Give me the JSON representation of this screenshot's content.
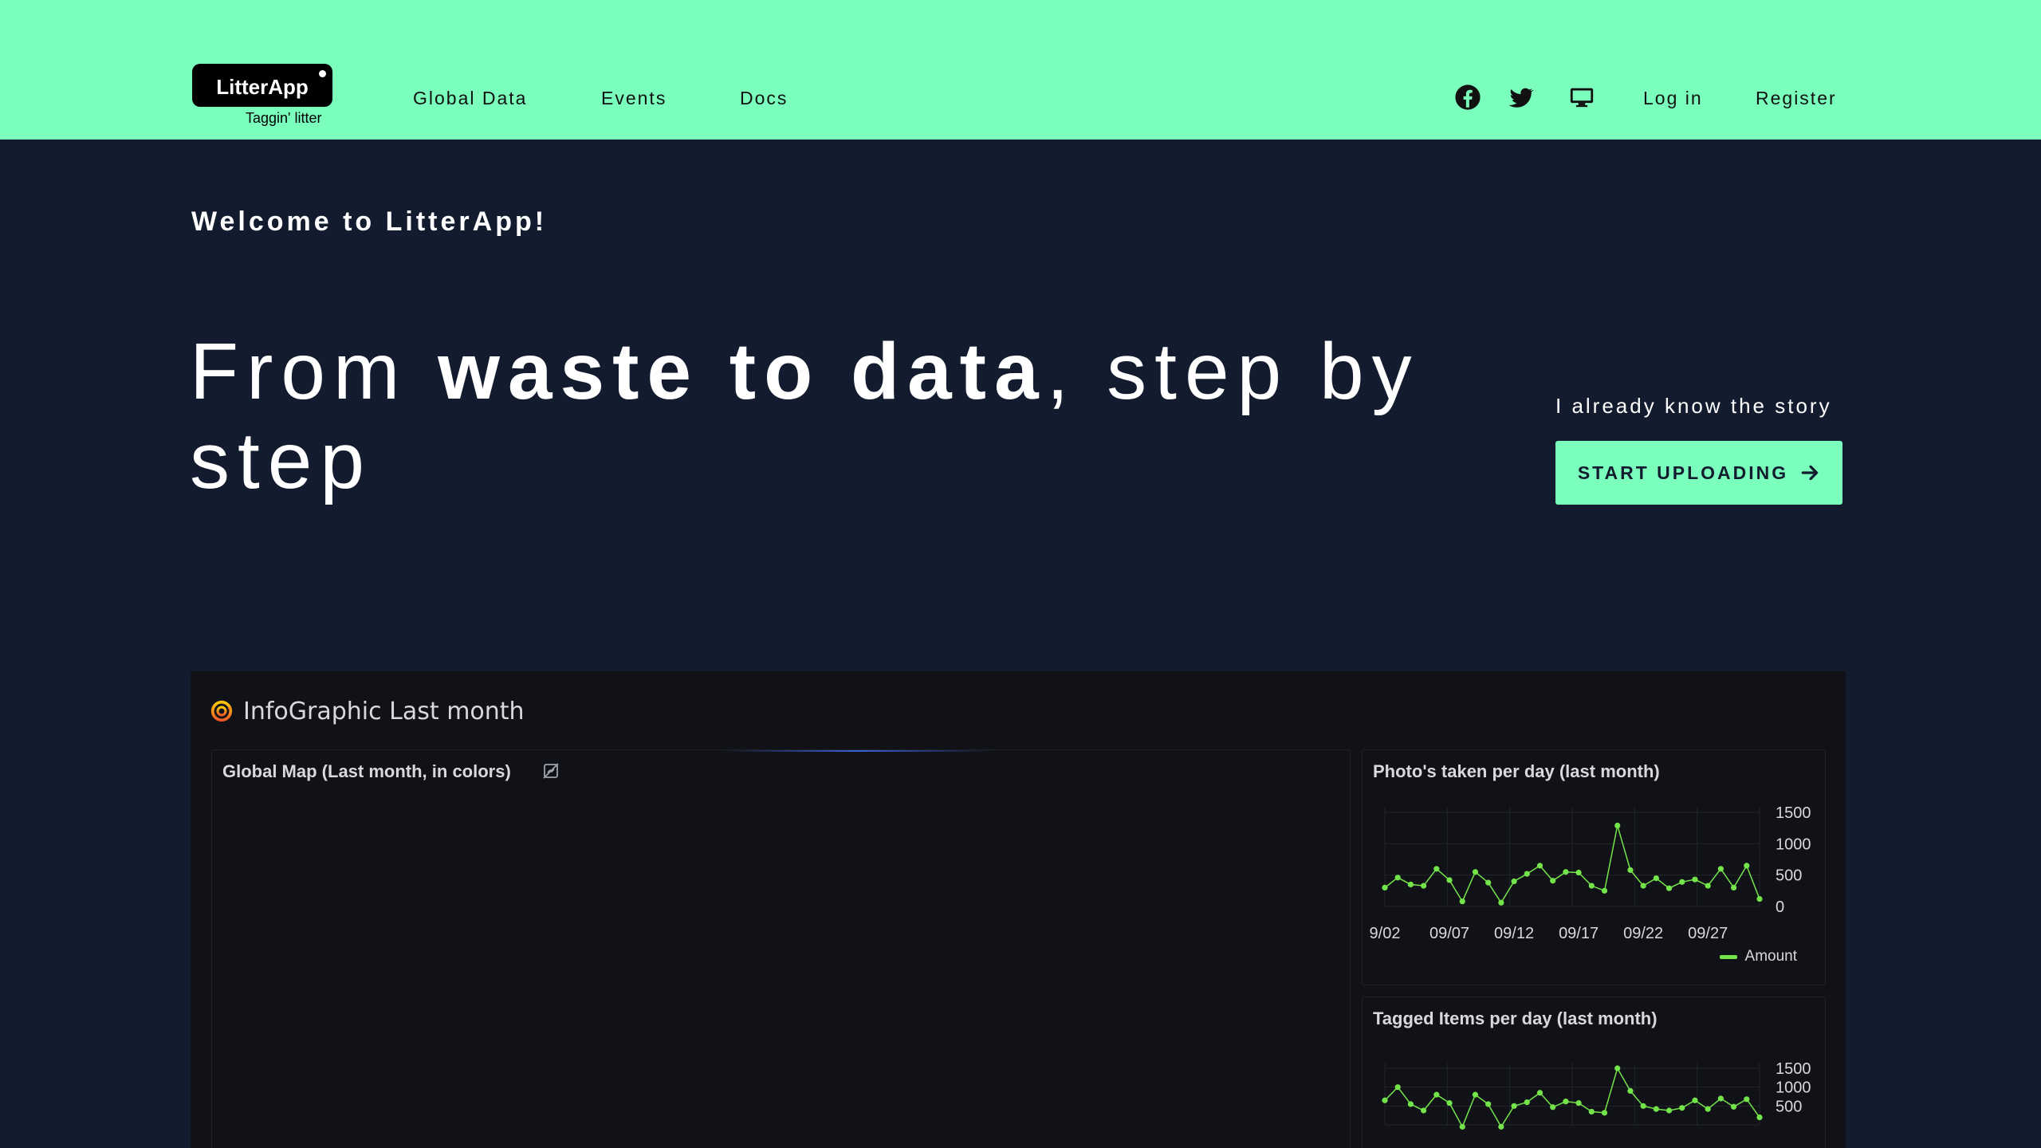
{
  "header": {
    "logo_text": "LitterApp",
    "logo_tagline": "Taggin' litter",
    "nav": [
      {
        "label": "Global Data"
      },
      {
        "label": "Events"
      },
      {
        "label": "Docs"
      }
    ],
    "social_icons": [
      "facebook-icon",
      "twitter-icon",
      "monitor-icon"
    ],
    "login_label": "Log in",
    "register_label": "Register",
    "bg_color": "#7affbd"
  },
  "hero": {
    "welcome": "Welcome to LitterApp!",
    "headline_pre": "From ",
    "headline_bold": "waste to data",
    "headline_post": ", step by step",
    "story_link": "I already know the story",
    "cta_label": "START UPLOADING",
    "bg_color": "#131c2e"
  },
  "dashboard": {
    "title": "InfoGraphic Last month",
    "map_panel_title": "Global Map (Last month, in colors)",
    "photos_panel_title": "Photo's taken per day (last month)",
    "tagged_panel_title": "Tagged Items per day (last month)",
    "legend_label": "Amount",
    "series_color": "#73e54b"
  },
  "chart_data": [
    {
      "type": "line",
      "title": "Photo's taken per day (last month)",
      "x_tick_labels": [
        "9/02",
        "09/07",
        "09/12",
        "09/17",
        "09/22",
        "09/27"
      ],
      "y_tick_labels": [
        "1500",
        "1000",
        "500",
        "0"
      ],
      "ylim": [
        0,
        1500
      ],
      "x": [
        "09/02",
        "09/03",
        "09/04",
        "09/05",
        "09/06",
        "09/07",
        "09/08",
        "09/09",
        "09/10",
        "09/11",
        "09/12",
        "09/13",
        "09/14",
        "09/15",
        "09/16",
        "09/17",
        "09/18",
        "09/19",
        "09/20",
        "09/21",
        "09/22",
        "09/23",
        "09/24",
        "09/25",
        "09/26",
        "09/27",
        "09/28",
        "09/29",
        "09/30"
      ],
      "series": [
        {
          "name": "Amount",
          "values": [
            300,
            460,
            350,
            330,
            600,
            420,
            80,
            550,
            380,
            60,
            400,
            520,
            650,
            410,
            550,
            540,
            330,
            250,
            1290,
            580,
            330,
            450,
            290,
            390,
            430,
            330,
            600,
            300,
            650,
            120
          ]
        }
      ],
      "legend": "bottom-right",
      "grid": true
    },
    {
      "type": "line",
      "title": "Tagged Items per day (last month)",
      "y_tick_labels": [
        "1500",
        "1000",
        "500"
      ],
      "ylim": [
        0,
        1500
      ],
      "series": [
        {
          "name": "Amount",
          "values": [
            650,
            1000,
            550,
            380,
            800,
            580,
            -50,
            800,
            550,
            -50,
            500,
            600,
            850,
            470,
            620,
            580,
            350,
            320,
            1500,
            900,
            500,
            420,
            380,
            450,
            650,
            420,
            700,
            480,
            680,
            200
          ]
        }
      ],
      "grid": true
    }
  ]
}
